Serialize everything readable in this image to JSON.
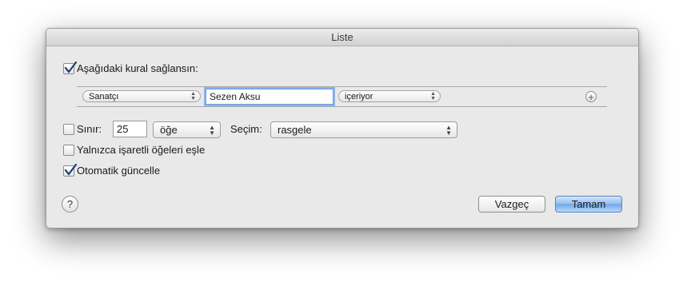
{
  "window": {
    "title": "Liste"
  },
  "rule_header": {
    "checked": true,
    "label": "Aşağıdaki kural sağlansın:"
  },
  "rule": {
    "field": "Sanatçı",
    "value": "Sezen Aksu",
    "operator": "içeriyor",
    "add_icon": "plus-circle-icon"
  },
  "limit": {
    "checked": false,
    "label": "Sınır:",
    "amount": "25",
    "unit": "öğe",
    "selection_label": "Seçim:",
    "selection": "rasgele"
  },
  "options": {
    "checked_only": {
      "checked": false,
      "label": "Yalnızca işaretli öğeleri eşle"
    },
    "live_update": {
      "checked": true,
      "label": "Otomatik güncelle"
    }
  },
  "help": {
    "icon": "question-mark-icon",
    "symbol": "?"
  },
  "buttons": {
    "cancel": "Vazgeç",
    "ok": "Tamam"
  },
  "colors": {
    "accent": "#6ea7e9",
    "focus": "#8db6ec"
  }
}
